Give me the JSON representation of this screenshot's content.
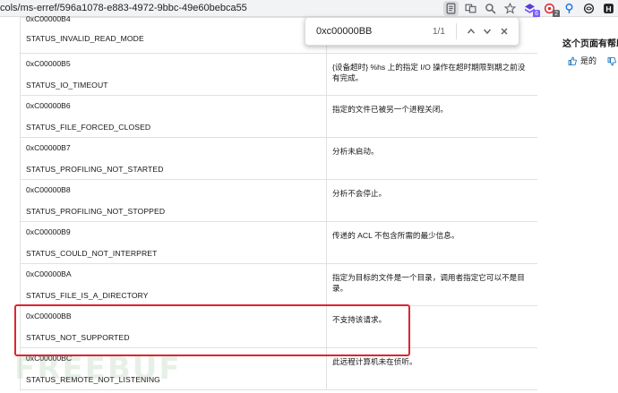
{
  "browser": {
    "url": "cols/ms-erref/596a1078-e883-4972-9bbc-49e60bebca55",
    "ext_badges": [
      "6",
      "2"
    ]
  },
  "findbar": {
    "query": "0xc00000BB",
    "count": "1/1"
  },
  "table": {
    "first_row": {
      "hex": "0xC00000B4",
      "name": "STATUS_INVALID_READ_MODE",
      "desc": ""
    },
    "rows": [
      {
        "hex": "0xC00000B5",
        "name": "STATUS_IO_TIMEOUT",
        "desc": "{设备超时} %hs 上的指定 I/O 操作在超时期限到期之前没有完成。"
      },
      {
        "hex": "0xC00000B6",
        "name": "STATUS_FILE_FORCED_CLOSED",
        "desc": "指定的文件已被另一个进程关闭。"
      },
      {
        "hex": "0xC00000B7",
        "name": "STATUS_PROFILING_NOT_STARTED",
        "desc": "分析未启动。"
      },
      {
        "hex": "0xC00000B8",
        "name": "STATUS_PROFILING_NOT_STOPPED",
        "desc": "分析不会停止。"
      },
      {
        "hex": "0xC00000B9",
        "name": "STATUS_COULD_NOT_INTERPRET",
        "desc": "传递的 ACL 不包含所需的最少信息。"
      },
      {
        "hex": "0xC00000BA",
        "name": "STATUS_FILE_IS_A_DIRECTORY",
        "desc": "指定为目标的文件是一个目录，调用者指定它可以不是目录。"
      },
      {
        "hex": "0xC00000BB",
        "name": "STATUS_NOT_SUPPORTED",
        "desc": "不支持该请求。"
      },
      {
        "hex": "0xC00000BC",
        "name": "STATUS_REMOTE_NOT_LISTENING",
        "desc": "此远程计算机未在侦听。"
      }
    ]
  },
  "feedback": {
    "title": "这个页面有帮助",
    "yes_label": "是的"
  },
  "watermark": "FREEBUF",
  "colors": {
    "highlight": "#e0242f",
    "border": "#e1e1e1",
    "accent": "#0067b8"
  }
}
